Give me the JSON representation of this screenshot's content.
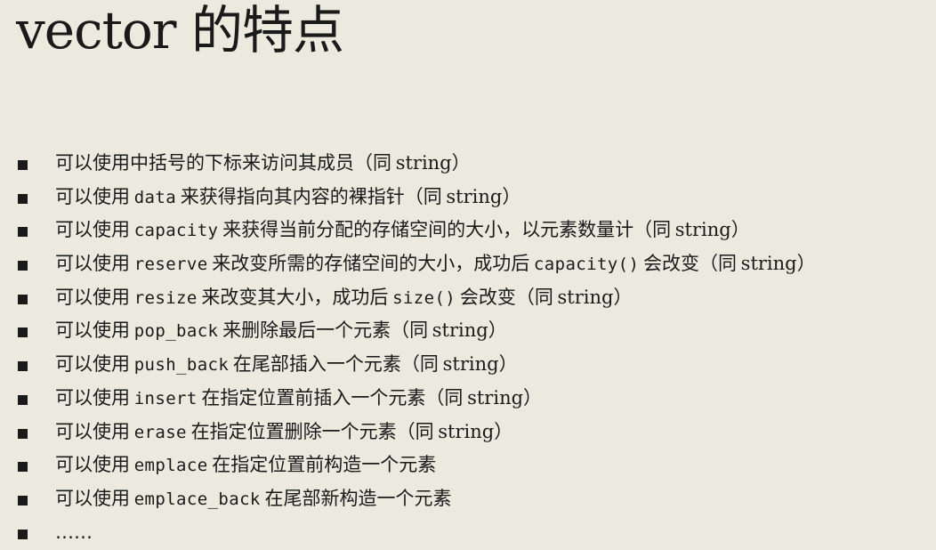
{
  "slide": {
    "title": "vector 的特点",
    "bullets": [
      {
        "parts": [
          {
            "text": "可以使用中括号的下标来访问其成员（同 "
          },
          {
            "text": "string",
            "style": "latin"
          },
          {
            "text": "）"
          }
        ]
      },
      {
        "parts": [
          {
            "text": "可以使用 "
          },
          {
            "text": "data",
            "style": "code"
          },
          {
            "text": " 来获得指向其内容的裸指针（同 "
          },
          {
            "text": "string",
            "style": "latin"
          },
          {
            "text": "）"
          }
        ]
      },
      {
        "parts": [
          {
            "text": "可以使用 "
          },
          {
            "text": "capacity",
            "style": "code"
          },
          {
            "text": " 来获得当前分配的存储空间的大小，以元素数量计（同 "
          },
          {
            "text": "string",
            "style": "latin"
          },
          {
            "text": "）"
          }
        ]
      },
      {
        "parts": [
          {
            "text": "可以使用 "
          },
          {
            "text": "reserve",
            "style": "code"
          },
          {
            "text": " 来改变所需的存储空间的大小，成功后 "
          },
          {
            "text": "capacity()",
            "style": "code"
          },
          {
            "text": " 会改变（同 "
          },
          {
            "text": "string",
            "style": "latin"
          },
          {
            "text": "）"
          }
        ]
      },
      {
        "parts": [
          {
            "text": "可以使用 "
          },
          {
            "text": "resize",
            "style": "code"
          },
          {
            "text": " 来改变其大小，成功后 "
          },
          {
            "text": "size()",
            "style": "code"
          },
          {
            "text": " 会改变（同 "
          },
          {
            "text": "string",
            "style": "latin"
          },
          {
            "text": "）"
          }
        ]
      },
      {
        "parts": [
          {
            "text": "可以使用 "
          },
          {
            "text": "pop_back",
            "style": "code"
          },
          {
            "text": " 来删除最后一个元素（同 "
          },
          {
            "text": "string",
            "style": "latin"
          },
          {
            "text": "）"
          }
        ]
      },
      {
        "parts": [
          {
            "text": "可以使用 "
          },
          {
            "text": "push_back",
            "style": "code"
          },
          {
            "text": " 在尾部插入一个元素（同 "
          },
          {
            "text": "string",
            "style": "latin"
          },
          {
            "text": "）"
          }
        ]
      },
      {
        "parts": [
          {
            "text": "可以使用 "
          },
          {
            "text": "insert",
            "style": "code"
          },
          {
            "text": " 在指定位置前插入一个元素（同 "
          },
          {
            "text": "string",
            "style": "latin"
          },
          {
            "text": "）"
          }
        ]
      },
      {
        "parts": [
          {
            "text": "可以使用 "
          },
          {
            "text": "erase",
            "style": "code"
          },
          {
            "text": " 在指定位置删除一个元素（同 "
          },
          {
            "text": "string",
            "style": "latin"
          },
          {
            "text": "）"
          }
        ]
      },
      {
        "parts": [
          {
            "text": "可以使用 "
          },
          {
            "text": "emplace",
            "style": "code"
          },
          {
            "text": " 在指定位置前构造一个元素"
          }
        ]
      },
      {
        "parts": [
          {
            "text": "可以使用 "
          },
          {
            "text": "emplace_back",
            "style": "code"
          },
          {
            "text": " 在尾部新构造一个元素"
          }
        ]
      },
      {
        "parts": [
          {
            "text": "……"
          }
        ]
      }
    ]
  }
}
